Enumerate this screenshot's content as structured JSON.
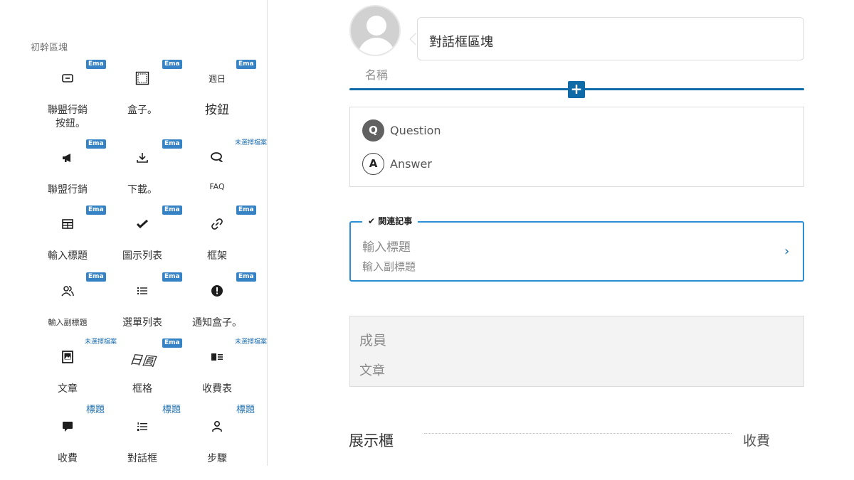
{
  "sidebar": {
    "title": "初幹區塊",
    "cells": [
      {
        "badge": "Ema",
        "badge_style": "tag",
        "icon": "minus-square-icon",
        "label": "聯盟行銷",
        "label_style": "strike",
        "sublabel": "按鈕。"
      },
      {
        "badge": "Ema",
        "badge_style": "tag",
        "icon": "dotted-box-icon",
        "label": "盒子。",
        "label_style": "",
        "sublabel": ""
      },
      {
        "badge": "Ema",
        "badge_style": "tag",
        "icon_text": "週日",
        "label": "按鈕",
        "label_style": "big",
        "sublabel": ""
      },
      {
        "badge": "Ema",
        "badge_style": "tag",
        "icon": "megaphone-icon",
        "label": "聯盟行銷",
        "label_style": "",
        "sublabel": ""
      },
      {
        "badge": "Ema",
        "badge_style": "tag",
        "icon": "download-icon",
        "label": "下載。",
        "label_style": "",
        "sublabel": ""
      },
      {
        "badge": "未選擇檔案",
        "badge_style": "note",
        "icon": "chat-bubbles-icon",
        "label": "FAQ",
        "label_style": "sm",
        "sublabel": ""
      },
      {
        "badge": "Ema",
        "badge_style": "tag",
        "icon": "table-icon",
        "label": "輸入標題",
        "label_style": "",
        "sublabel": ""
      },
      {
        "badge": "Ema",
        "badge_style": "tag",
        "icon": "checkmark-icon",
        "label": "圖示列表",
        "label_style": "",
        "sublabel": ""
      },
      {
        "badge": "Ema",
        "badge_style": "tag",
        "icon": "link-icon",
        "label": "框架",
        "label_style": "",
        "sublabel": ""
      },
      {
        "badge": "Ema",
        "badge_style": "tag",
        "icon": "users-icon",
        "label": "輸入副標題",
        "label_style": "sm",
        "sublabel": ""
      },
      {
        "badge": "Ema",
        "badge_style": "tag",
        "icon": "list-icon",
        "label": "選單列表",
        "label_style": "",
        "sublabel": ""
      },
      {
        "badge": "Ema",
        "badge_style": "tag",
        "icon": "alert-icon",
        "label": "通知盒子。",
        "label_style": "",
        "sublabel": ""
      },
      {
        "badge": "未選擇檔案",
        "badge_style": "note",
        "icon": "gallery-icon",
        "label": "文章",
        "label_style": "",
        "sublabel": ""
      },
      {
        "badge": "Ema",
        "badge_style": "tag",
        "icon_text": "日圓",
        "icon_style": "rot",
        "label": "框格",
        "label_style": "",
        "sublabel": ""
      },
      {
        "badge": "未選擇檔案",
        "badge_style": "note",
        "icon": "media-text-icon",
        "label": "收費表",
        "label_style": "",
        "sublabel": ""
      },
      {
        "badge": "標題",
        "badge_style": "title",
        "icon": "speech-bubble-icon",
        "label": "收費",
        "label_style": "",
        "sublabel": ""
      },
      {
        "badge": "標題",
        "badge_style": "title",
        "icon": "numbered-list-icon",
        "label": "對話框",
        "label_style": "",
        "sublabel": ""
      },
      {
        "badge": "標題",
        "badge_style": "title",
        "icon": "person-icon",
        "label": "步驟",
        "label_style": "",
        "sublabel": ""
      }
    ]
  },
  "editor": {
    "speaker_name": "名稱",
    "bubble_text": "對話框區塊",
    "add_block_label": "+",
    "faq": {
      "q_mark": "Q",
      "question": "Question",
      "a_mark": "A",
      "answer": "Answer"
    },
    "related": {
      "legend": "✔ 関連記事",
      "title_placeholder": "輸入標題",
      "subtitle_placeholder": "輸入副標題",
      "arrow": "›"
    },
    "member": {
      "name": "成員",
      "text": "文章"
    },
    "showcase": {
      "label": "展示櫃",
      "price": "收費"
    }
  },
  "colors": {
    "accent": "#0f6aa8",
    "badge": "#3582c4",
    "focus_border": "#2b8fd6"
  }
}
